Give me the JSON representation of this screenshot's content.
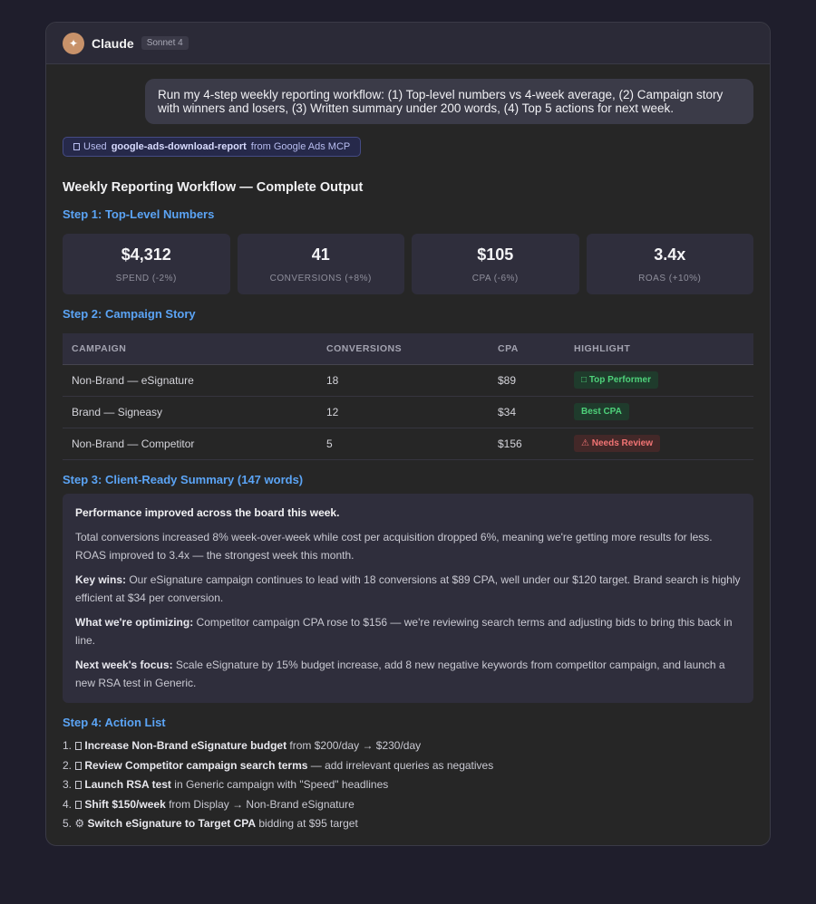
{
  "app": {
    "name": "Claude",
    "model": "Sonnet 4"
  },
  "user_message": "Run my 4-step weekly reporting workflow: (1) Top-level numbers vs 4-week average, (2) Campaign story with winners and losers, (3) Written summary under 200 words, (4) Top 5 actions for next week.",
  "tool_use": {
    "prefix": "Used",
    "tool": "google-ads-download-report",
    "suffix": "from Google Ads MCP"
  },
  "output_title": "Weekly Reporting Workflow — Complete Output",
  "step1": {
    "title": "Step 1: Top-Level Numbers",
    "metrics": [
      {
        "value": "$4,312",
        "label": "SPEND (-2%)"
      },
      {
        "value": "41",
        "label": "CONVERSIONS (+8%)"
      },
      {
        "value": "$105",
        "label": "CPA (-6%)"
      },
      {
        "value": "3.4x",
        "label": "ROAS (+10%)"
      }
    ]
  },
  "step2": {
    "title": "Step 2: Campaign Story",
    "columns": [
      "CAMPAIGN",
      "CONVERSIONS",
      "CPA",
      "HIGHLIGHT"
    ],
    "rows": [
      {
        "campaign": "Non-Brand — eSignature",
        "conversions": "18",
        "cpa": "$89",
        "highlight": "□ Top Performer",
        "tone": "green"
      },
      {
        "campaign": "Brand — Signeasy",
        "conversions": "12",
        "cpa": "$34",
        "highlight": "Best CPA",
        "tone": "green"
      },
      {
        "campaign": "Non-Brand — Competitor",
        "conversions": "5",
        "cpa": "$156",
        "highlight": "⚠ Needs Review",
        "tone": "red"
      }
    ]
  },
  "step3": {
    "title": "Step 3: Client-Ready Summary (147 words)",
    "headline": "Performance improved across the board this week.",
    "intro": "Total conversions increased 8% week-over-week while cost per acquisition dropped 6%, meaning we're getting more results for less. ROAS improved to 3.4x — the strongest week this month.",
    "paragraphs": [
      {
        "lead": "Key wins:",
        "text": " Our eSignature campaign continues to lead with 18 conversions at $89 CPA, well under our $120 target. Brand search is highly efficient at $34 per conversion."
      },
      {
        "lead": "What we're optimizing:",
        "text": " Competitor campaign CPA rose to $156 — we're reviewing search terms and adjusting bids to bring this back in line."
      },
      {
        "lead": "Next week's focus:",
        "text": " Scale eSignature by 15% budget increase, add 8 new negative keywords from competitor campaign, and launch a new RSA test in Generic."
      }
    ]
  },
  "step4": {
    "title": "Step 4: Action List",
    "actions": [
      {
        "num": "1.",
        "icon": "box-icon",
        "bold": "Increase Non-Brand eSignature budget",
        "rest": " from $200/day → $230/day"
      },
      {
        "num": "2.",
        "icon": "box-icon",
        "bold": "Review Competitor campaign search terms",
        "rest": " — add irrelevant queries as negatives"
      },
      {
        "num": "3.",
        "icon": "box-icon",
        "bold": "Launch RSA test",
        "rest": " in Generic campaign with \"Speed\" headlines"
      },
      {
        "num": "4.",
        "icon": "box-icon",
        "bold": "Shift $150/week",
        "rest": " from Display → Non-Brand eSignature"
      },
      {
        "num": "5.",
        "icon": "gear-icon",
        "bold": "Switch eSignature to Target CPA",
        "rest": " bidding at $95 target"
      }
    ]
  }
}
